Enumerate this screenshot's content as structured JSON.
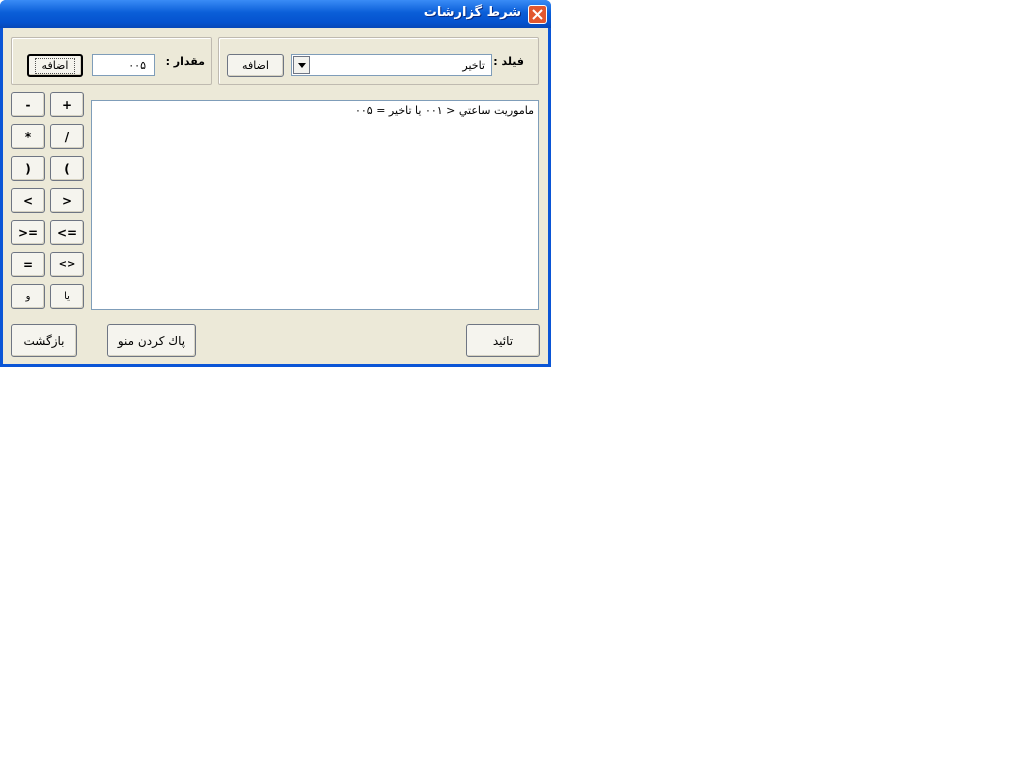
{
  "window": {
    "title": "شرط گزارشات",
    "close_icon": "close-icon"
  },
  "field_group": {
    "label": "فيلد :",
    "combo_value": "تاخير",
    "dropdown_icon": "chevron-down-icon",
    "add_label": "اضافه"
  },
  "value_group": {
    "label": "مقدار :",
    "input_value": "۰۰۵",
    "add_label": "اضافه"
  },
  "operators": [
    {
      "label": "+"
    },
    {
      "label": "-"
    },
    {
      "label": "/"
    },
    {
      "label": "*"
    },
    {
      "label": "("
    },
    {
      "label": ")"
    },
    {
      "label": ">"
    },
    {
      "label": "<"
    },
    {
      "label": "<="
    },
    {
      "label": ">="
    },
    {
      "label": "<>"
    },
    {
      "label": "="
    },
    {
      "label": "يا"
    },
    {
      "label": "و"
    }
  ],
  "memo": {
    "text": "ماموريت ساعتي < ۰۰۱ يا تاخير = ۰۰۵"
  },
  "footer": {
    "confirm_label": "تائيد",
    "clear_label": "پاك كردن منو",
    "back_label": "بازگشت"
  },
  "colors": {
    "title_bar": "#0a5ed8",
    "window_bg": "#ece9d8",
    "close_button": "#e2572f"
  }
}
